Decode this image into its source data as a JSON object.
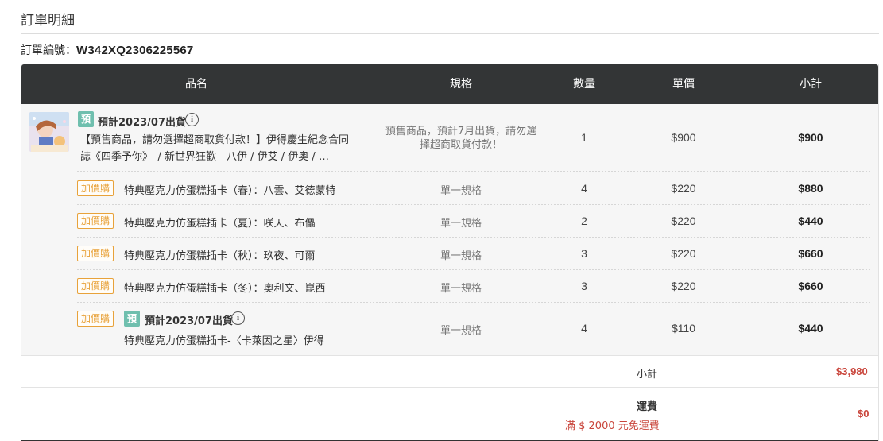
{
  "page": {
    "title": "訂單明細",
    "order_label": "訂單編號：",
    "order_number": "W342XQ2306225567"
  },
  "table": {
    "headers": {
      "name": "品名",
      "spec": "規格",
      "qty": "數量",
      "price": "單價",
      "subtotal": "小計"
    },
    "main_item": {
      "badge": "預",
      "ship_date": "預計2023/07出貨",
      "info_icon": "i",
      "name_line1": "【預售商品，請勿選擇超商取貨付款！】伊得慶生紀念合同",
      "name_line2": "誌《四季予你》　/ 新世界狂歡　八伊 / 伊艾 / 伊奧 / …",
      "spec_line1": "預售商品，預計7月出貨，請勿選",
      "spec_line2": "擇超商取貨付款！",
      "qty": "1",
      "price": "$900",
      "subtotal": "$900"
    },
    "addons": [
      {
        "badge": "加價購",
        "name": "特典壓克力仿蛋糕插卡（春）：八雲、艾德蒙特",
        "spec": "單一規格",
        "qty": "4",
        "price": "$220",
        "subtotal": "$880"
      },
      {
        "badge": "加價購",
        "name": "特典壓克力仿蛋糕插卡（夏）：咲天、布儡",
        "spec": "單一規格",
        "qty": "2",
        "price": "$220",
        "subtotal": "$440"
      },
      {
        "badge": "加價購",
        "name": "特典壓克力仿蛋糕插卡（秋）：玖夜、可爾",
        "spec": "單一規格",
        "qty": "3",
        "price": "$220",
        "subtotal": "$660"
      },
      {
        "badge": "加價購",
        "name": "特典壓克力仿蛋糕插卡（冬）：奧利文、崑西",
        "spec": "單一規格",
        "qty": "3",
        "price": "$220",
        "subtotal": "$660"
      },
      {
        "badge": "加價購",
        "pre_badge": "預",
        "ship_date": "預計2023/07出貨",
        "info_icon": "i",
        "name": "特典壓克力仿蛋糕插卡-〈卡萊因之星〉伊得",
        "spec": "單一規格",
        "qty": "4",
        "price": "$110",
        "subtotal": "$440"
      }
    ]
  },
  "summary": {
    "subtotal_label": "小計",
    "subtotal_value": "$3,980",
    "shipping_label": "運費",
    "shipping_note": "滿 $ 2000 元免運費",
    "shipping_value": "$0"
  },
  "colors": {
    "header_bg": "#333536",
    "pre_badge": "#6fbfae",
    "addon_badge": "#e8a23a",
    "price_accent": "#c9453b"
  }
}
